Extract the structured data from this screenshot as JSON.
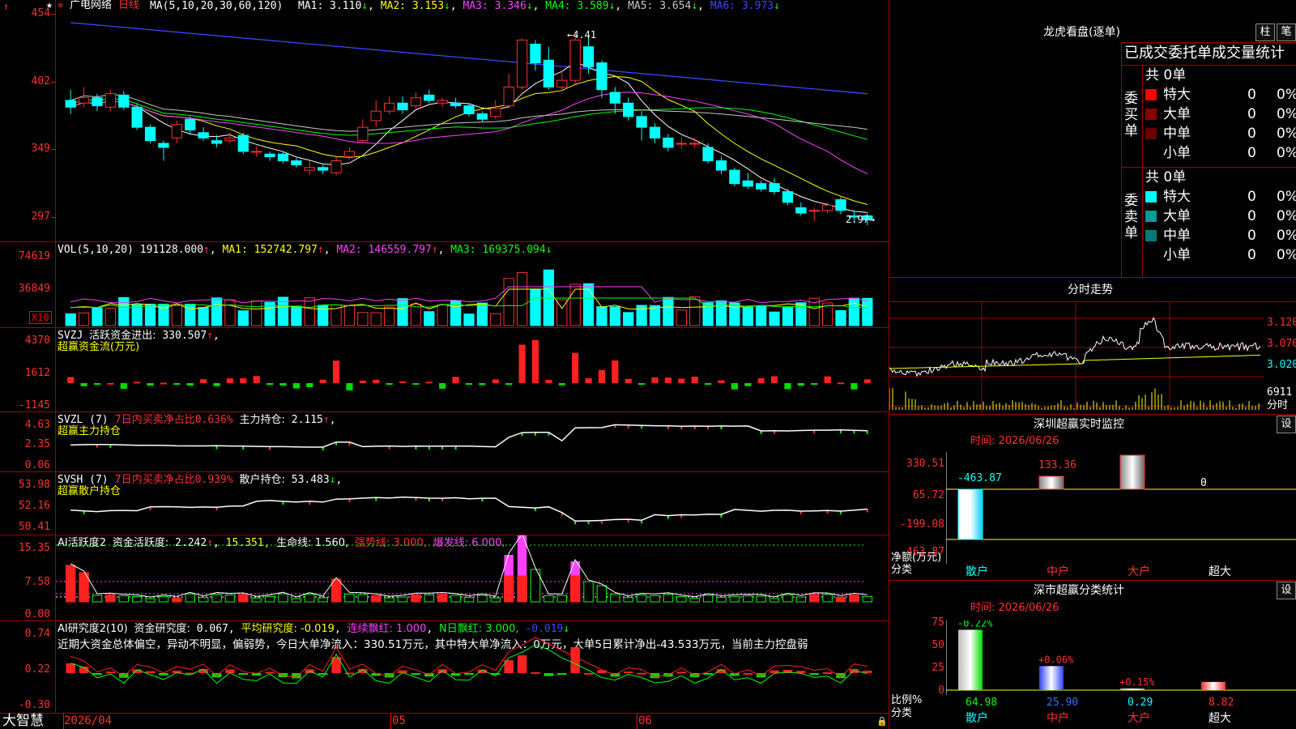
{
  "left": {
    "star": "★",
    "stock_name": "广电网络",
    "period": "日线",
    "ma_label": "MA(5,10,20,30,60,120)",
    "ma": [
      {
        "name": "MA1:",
        "value": "3.110",
        "arrow": "↓",
        "color": "#ffffff"
      },
      {
        "name": "MA2:",
        "value": "3.153",
        "arrow": "↓",
        "color": "#ffff00"
      },
      {
        "name": "MA3:",
        "value": "3.346",
        "arrow": "↓",
        "color": "#ff40ff"
      },
      {
        "name": "MA4:",
        "value": "3.589",
        "arrow": "↓",
        "color": "#00ff00"
      },
      {
        "name": "MA5:",
        "value": "3.654",
        "arrow": "↓",
        "color": "#c8c8c8"
      },
      {
        "name": "MA6:",
        "value": "3.973",
        "arrow": "↓",
        "color": "#3b46ff"
      }
    ],
    "price_axis": [
      "454",
      "402",
      "349",
      "297"
    ],
    "high_mark": "4.41",
    "low_mark": "2.97",
    "vol_header": {
      "label": "VOL(5,10,20)",
      "value": "191128.000",
      "ma1": "MA1: 152742.797",
      "ma2": "MA2: 146559.797",
      "ma3": "MA3: 169375.094"
    },
    "vol_axis": [
      "74619",
      "36849"
    ],
    "vol_unit": "X10",
    "svzj": {
      "name": "SVZJ",
      "label": "活跃资金进出:",
      "value": "330.507",
      "title": "超赢资金流(万元)",
      "axis": [
        "4370",
        "1612",
        "-1145"
      ]
    },
    "svzl": {
      "name": "SVZL (7)",
      "ratio_label": "7日内买卖净占比",
      "ratio": "0.636%",
      "hold_label": "主力持仓:",
      "hold": "2.115",
      "title": "超赢主力持仓",
      "axis": [
        "4.63",
        "2.35",
        "0.06"
      ]
    },
    "svsh": {
      "name": "SVSH (7)",
      "ratio_label": "7日内买卖净占比",
      "ratio": "0.939%",
      "hold_label": "散户持仓:",
      "hold": "53.483",
      "title": "超赢散户持仓",
      "axis": [
        "53.98",
        "52.16",
        "50.41"
      ]
    },
    "ai_active": {
      "name": "AI活跃度2",
      "label": "资金活跃度:",
      "value": "2.242",
      "v2": "15.351,",
      "life": "生命线: 1.560,",
      "strong": "强势线: 3.000,",
      "burst": "爆发线: 6.000,",
      "axis": [
        "15.35",
        "7.58",
        "0.00"
      ]
    },
    "ai_research": {
      "name": "AI研究度2(10)",
      "label": "资金研究度:",
      "value": "0.067",
      "avg": "平均研究度: -0.019",
      "cont": "连续飘红: 1.000",
      "n": "N日飘红: 3.000,",
      "neg": "-0.019",
      "axis": [
        "0.74",
        "0.22",
        "-0.30"
      ],
      "comment": "近期大资金总体偏空，异动不明显，偏弱势，今日大单净流入：330.51万元，其中特大单净流入：0万元，大单5日累计净出-43.533万元，当前主力控盘弱"
    },
    "dates": [
      "2026/04",
      "05",
      "06"
    ],
    "footer_logo": "大智慧"
  },
  "chart_data": [
    {
      "type": "candlestick",
      "title": "广电网络 日线",
      "ylim": [
        2.97,
        4.54
      ],
      "y_ticks": [
        "454",
        "402",
        "349",
        "297"
      ],
      "candles": [
        [
          3.9,
          3.85,
          3.98,
          3.8
        ],
        [
          3.88,
          3.92,
          4.0,
          3.85
        ],
        [
          3.92,
          3.86,
          3.95,
          3.82
        ],
        [
          3.85,
          3.95,
          3.98,
          3.82
        ],
        [
          3.94,
          3.85,
          3.97,
          3.83
        ],
        [
          3.85,
          3.7,
          3.88,
          3.68
        ],
        [
          3.7,
          3.6,
          3.72,
          3.58
        ],
        [
          3.58,
          3.55,
          3.6,
          3.45
        ],
        [
          3.62,
          3.72,
          3.75,
          3.58
        ],
        [
          3.76,
          3.68,
          3.78,
          3.65
        ],
        [
          3.66,
          3.62,
          3.7,
          3.6
        ],
        [
          3.6,
          3.58,
          3.64,
          3.55
        ],
        [
          3.6,
          3.62,
          3.66,
          3.58
        ],
        [
          3.64,
          3.52,
          3.66,
          3.5
        ],
        [
          3.52,
          3.52,
          3.56,
          3.48
        ],
        [
          3.5,
          3.48,
          3.52,
          3.45
        ],
        [
          3.5,
          3.45,
          3.52,
          3.43
        ],
        [
          3.45,
          3.42,
          3.47,
          3.4
        ],
        [
          3.38,
          3.4,
          3.45,
          3.35
        ],
        [
          3.4,
          3.38,
          3.42,
          3.35
        ],
        [
          3.36,
          3.45,
          3.48,
          3.34
        ],
        [
          3.48,
          3.52,
          3.55,
          3.46
        ],
        [
          3.6,
          3.7,
          3.76,
          3.58
        ],
        [
          3.75,
          3.82,
          3.9,
          3.7
        ],
        [
          3.82,
          3.88,
          3.93,
          3.8
        ],
        [
          3.88,
          3.83,
          3.93,
          3.8
        ],
        [
          3.86,
          3.92,
          3.96,
          3.84
        ],
        [
          3.94,
          3.9,
          3.98,
          3.88
        ],
        [
          3.88,
          3.9,
          3.92,
          3.85
        ],
        [
          3.88,
          3.86,
          3.92,
          3.84
        ],
        [
          3.86,
          3.8,
          3.88,
          3.78
        ],
        [
          3.8,
          3.76,
          3.82,
          3.74
        ],
        [
          3.78,
          3.84,
          3.9,
          3.76
        ],
        [
          3.86,
          4.0,
          4.1,
          3.84
        ],
        [
          4.0,
          4.35,
          4.36,
          3.98
        ],
        [
          4.32,
          4.18,
          4.35,
          4.12
        ],
        [
          4.2,
          4.0,
          4.3,
          3.98
        ],
        [
          4.0,
          4.05,
          4.12,
          3.98
        ],
        [
          4.05,
          4.35,
          4.41,
          4.02
        ],
        [
          4.3,
          4.15,
          4.38,
          4.1
        ],
        [
          4.18,
          3.98,
          4.2,
          3.92
        ],
        [
          3.96,
          3.88,
          4.0,
          3.8
        ],
        [
          3.88,
          3.78,
          3.92,
          3.75
        ],
        [
          3.78,
          3.7,
          3.82,
          3.6
        ],
        [
          3.7,
          3.62,
          3.73,
          3.58
        ],
        [
          3.62,
          3.55,
          3.65,
          3.52
        ],
        [
          3.58,
          3.58,
          3.62,
          3.54
        ],
        [
          3.58,
          3.58,
          3.62,
          3.55
        ],
        [
          3.55,
          3.45,
          3.58,
          3.43
        ],
        [
          3.45,
          3.38,
          3.48,
          3.35
        ],
        [
          3.38,
          3.28,
          3.4,
          3.26
        ],
        [
          3.3,
          3.26,
          3.36,
          3.24
        ],
        [
          3.28,
          3.24,
          3.3,
          3.22
        ],
        [
          3.28,
          3.22,
          3.32,
          3.2
        ],
        [
          3.22,
          3.14,
          3.24,
          3.12
        ],
        [
          3.1,
          3.06,
          3.14,
          3.04
        ],
        [
          3.08,
          3.08,
          3.1,
          3.0
        ],
        [
          3.08,
          3.12,
          3.14,
          3.06
        ],
        [
          3.16,
          3.08,
          3.18,
          3.05
        ],
        [
          3.04,
          3.03,
          3.08,
          3.0
        ],
        [
          3.04,
          3.01,
          3.06,
          2.97
        ]
      ]
    }
  ],
  "right": {
    "lhkp_title": "龙虎看盘(逐单)",
    "btn_zhu": "柱",
    "btn_bi": "笔",
    "stats_title": "已成交委托单成交量统计",
    "buy_side": "委买单",
    "sell_side": "委卖单",
    "buy_total": "共 0单",
    "sell_total": "共 0单",
    "buy_rows": [
      {
        "label": "特大",
        "count": "0",
        "pct": "0%",
        "color": "#ff0000"
      },
      {
        "label": "大单",
        "count": "0",
        "pct": "0%",
        "color": "#8a0000"
      },
      {
        "label": "中单",
        "count": "0",
        "pct": "0%",
        "color": "#6a0000"
      },
      {
        "label": "小单",
        "count": "0",
        "pct": "0%",
        "color": "#000000"
      }
    ],
    "sell_rows": [
      {
        "label": "特大",
        "count": "0",
        "pct": "0%",
        "color": "#00ffff"
      },
      {
        "label": "大单",
        "count": "0",
        "pct": "0%",
        "color": "#009a9a"
      },
      {
        "label": "中单",
        "count": "0",
        "pct": "0%",
        "color": "#007a7a"
      },
      {
        "label": "小单",
        "count": "0",
        "pct": "0%",
        "color": "#000000"
      }
    ],
    "fenshi_title": "分时走势",
    "fenshi_axis": [
      "3.120",
      "3.070",
      "3.020",
      "6911"
    ],
    "fenshi_unit": "分时",
    "sz_title": "深圳超赢实时监控",
    "sz_btn": "设",
    "sz_time": "时间: 2026/06/26",
    "sz_axis": [
      "330.51",
      "65.72",
      "-199.08",
      "-463.87"
    ],
    "sz_ylabel": "净额(万元)",
    "sz_xlabel": "分类",
    "sz_values": [
      {
        "cat": "散户",
        "value": "-463.87"
      },
      {
        "cat": "中户",
        "value": "133.36"
      },
      {
        "cat": "大户",
        "value": "330.51"
      },
      {
        "cat": "超大",
        "value": "0"
      }
    ],
    "ss_title": "深市超赢分类统计",
    "ss_btn": "设",
    "ss_time": "时间: 2026/06/26",
    "ss_axis": [
      "75",
      "50",
      "25",
      "0"
    ],
    "ss_ylabel": "比例%",
    "ss_xlabel": "分类",
    "ss_values": [
      {
        "cat": "散户",
        "value": "64.98",
        "delta": "-0.22%"
      },
      {
        "cat": "中户",
        "value": "25.90",
        "delta": "+0.06%"
      },
      {
        "cat": "大户",
        "value": "0.29",
        "delta": "+0.15%"
      },
      {
        "cat": "超大",
        "value": "8.82",
        "delta": ""
      }
    ]
  }
}
